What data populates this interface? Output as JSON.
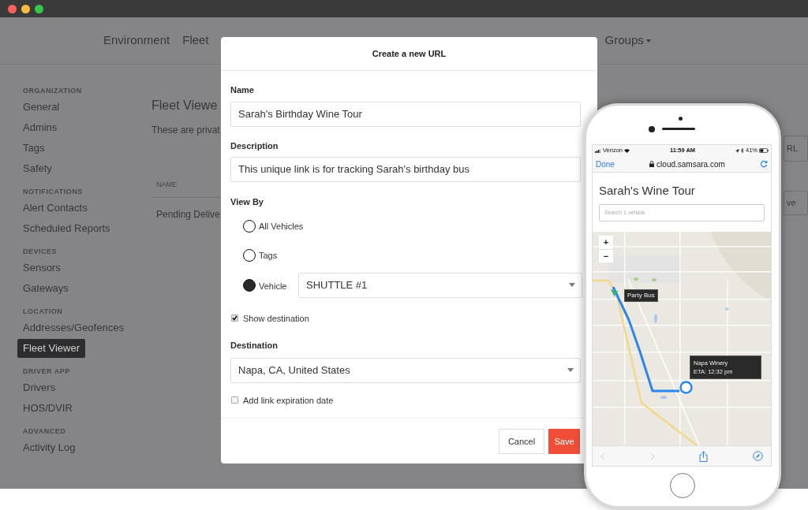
{
  "top_nav": {
    "items": [
      {
        "label": "Environment",
        "has_menu": false
      },
      {
        "label": "Fleet",
        "has_menu": false
      },
      {
        "label": "Groups",
        "has_menu": true
      }
    ]
  },
  "sidebar": {
    "sections": [
      {
        "heading": "ORGANIZATION",
        "items": [
          {
            "label": "General",
            "selected": false
          },
          {
            "label": "Admins",
            "selected": false
          },
          {
            "label": "Tags",
            "selected": false
          },
          {
            "label": "Safety",
            "selected": false
          }
        ]
      },
      {
        "heading": "NOTIFICATIONS",
        "items": [
          {
            "label": "Alert Contacts",
            "selected": false
          },
          {
            "label": "Scheduled Reports",
            "selected": false
          }
        ]
      },
      {
        "heading": "DEVICES",
        "items": [
          {
            "label": "Sensors",
            "selected": false
          },
          {
            "label": "Gateways",
            "selected": false
          }
        ]
      },
      {
        "heading": "LOCATION",
        "items": [
          {
            "label": "Addresses/Geofences",
            "selected": false
          },
          {
            "label": "Fleet Viewer",
            "selected": true
          }
        ]
      },
      {
        "heading": "DRIVER APP",
        "items": [
          {
            "label": "Drivers",
            "selected": false
          },
          {
            "label": "HOS/DVIR",
            "selected": false
          }
        ]
      },
      {
        "heading": "ADVANCED",
        "items": [
          {
            "label": "Activity Log",
            "selected": false
          }
        ]
      }
    ]
  },
  "main": {
    "title": "Fleet Viewe",
    "subtitle": "These are privat",
    "table": {
      "columns": [
        "NAME"
      ],
      "rows": [
        [
          "Pending Delive"
        ]
      ]
    },
    "buttons": [
      "RL",
      "ve"
    ]
  },
  "modal": {
    "title": "Create a new URL",
    "name": {
      "label": "Name",
      "value": "Sarah's Birthday Wine Tour"
    },
    "description": {
      "label": "Description",
      "value": "This unique link is for tracking Sarah's birthday bus"
    },
    "view_by": {
      "label": "View By",
      "options": [
        {
          "label": "All Vehicles",
          "selected": false
        },
        {
          "label": "Tags",
          "selected": false
        },
        {
          "label": "Vehicle",
          "selected": true,
          "value": "SHUTTLE #1"
        }
      ]
    },
    "show_destination": {
      "label": "Show destination",
      "checked": true
    },
    "destination": {
      "label": "Destination",
      "value": "Napa, CA, United States"
    },
    "expiration": {
      "label": "Add link expiration date",
      "checked": false
    },
    "buttons": [
      {
        "label": "Cancel",
        "kind": "secondary"
      },
      {
        "label": "Save",
        "kind": "primary"
      }
    ]
  },
  "phone": {
    "status_bar": {
      "carrier": "Verizon",
      "time": "11:59 AM",
      "battery": "41%"
    },
    "browser": {
      "done": "Done",
      "url": "cloud.samsara.com"
    },
    "page_title": "Sarah's Wine Tour",
    "search": {
      "placeholder": "Search 1 vehicle"
    },
    "map": {
      "kind": "picture",
      "zoom_in": "+",
      "zoom_out": "−",
      "vehicle_label": "Party Bus",
      "destination_name": "Napa Winery",
      "destination_eta": "ETA: 12:32 pm"
    },
    "toolbar": {
      "back_enabled": false,
      "forward_enabled": false
    }
  }
}
